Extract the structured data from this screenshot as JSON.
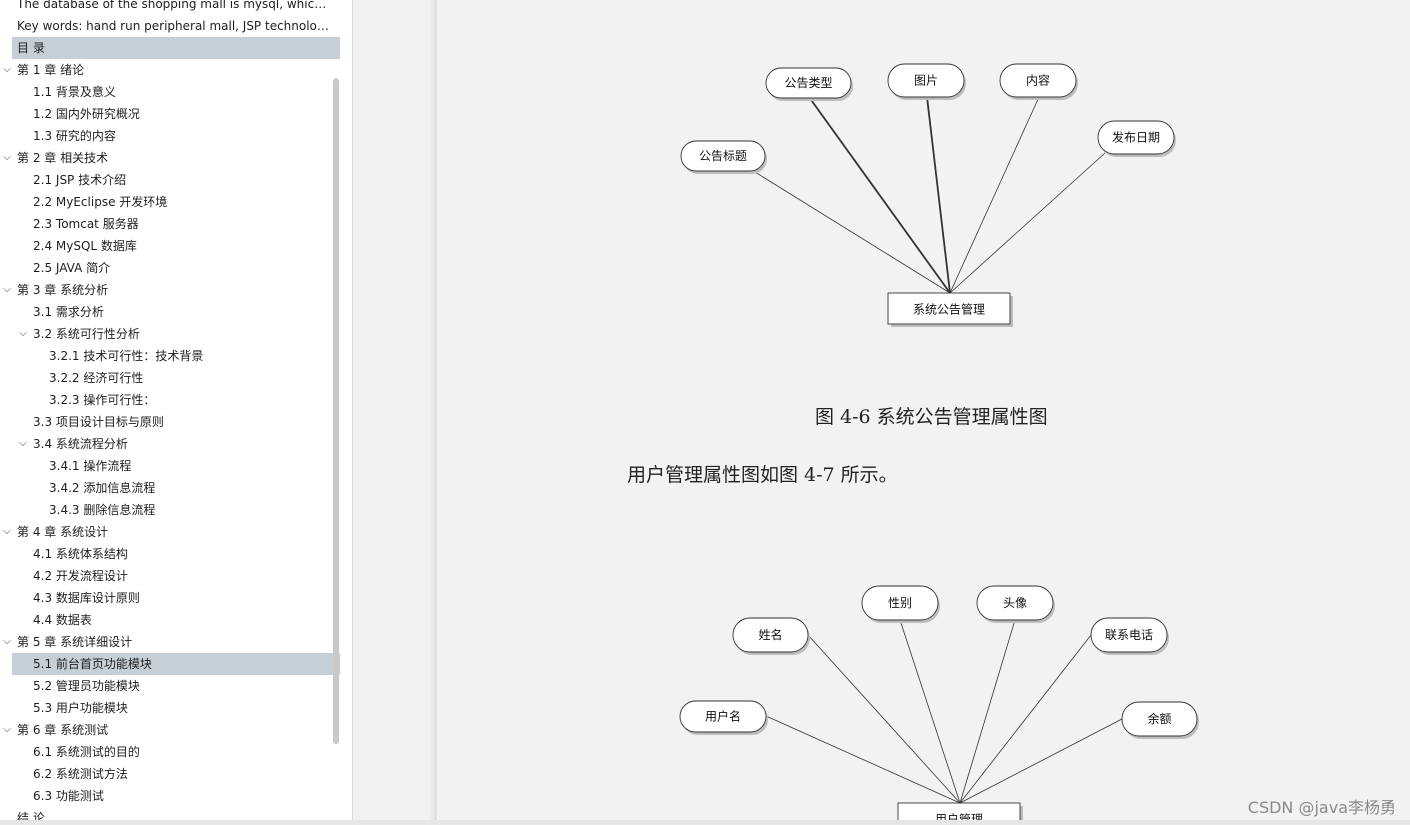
{
  "outline": [
    {
      "text": "The database of the shopping mall is mysql, which n...",
      "level": 0,
      "expander": false,
      "selected": false
    },
    {
      "text": "Key words: hand run peripheral mall, JSP technolog ...",
      "level": 0,
      "expander": false,
      "selected": false
    },
    {
      "text": "目  录",
      "level": 0,
      "expander": false,
      "selected": true
    },
    {
      "text": "第 1 章  绪论",
      "level": 0,
      "expander": true,
      "selected": false
    },
    {
      "text": "1.1 背景及意义",
      "level": 1,
      "expander": false,
      "selected": false
    },
    {
      "text": "1.2  国内外研究概况",
      "level": 1,
      "expander": false,
      "selected": false
    },
    {
      "text": "1.3  研究的内容",
      "level": 1,
      "expander": false,
      "selected": false
    },
    {
      "text": "第 2 章  相关技术",
      "level": 0,
      "expander": true,
      "selected": false
    },
    {
      "text": "2.1 JSP 技术介绍",
      "level": 1,
      "expander": false,
      "selected": false
    },
    {
      "text": "2.2 MyEclipse 开发环境",
      "level": 1,
      "expander": false,
      "selected": false
    },
    {
      "text": "2.3 Tomcat 服务器",
      "level": 1,
      "expander": false,
      "selected": false
    },
    {
      "text": "2.4 MySQL 数据库",
      "level": 1,
      "expander": false,
      "selected": false
    },
    {
      "text": "2.5 JAVA 简介",
      "level": 1,
      "expander": false,
      "selected": false
    },
    {
      "text": "第 3 章  系统分析",
      "level": 0,
      "expander": true,
      "selected": false
    },
    {
      "text": "3.1  需求分析",
      "level": 1,
      "expander": false,
      "selected": false
    },
    {
      "text": "3.2  系统可行性分析",
      "level": 1,
      "expander": true,
      "selected": false
    },
    {
      "text": "3.2.1 技术可行性：技术背景",
      "level": 2,
      "expander": false,
      "selected": false
    },
    {
      "text": "3.2.2 经济可行性",
      "level": 2,
      "expander": false,
      "selected": false
    },
    {
      "text": "3.2.3 操作可行性：",
      "level": 2,
      "expander": false,
      "selected": false
    },
    {
      "text": "3.3  项目设计目标与原则",
      "level": 1,
      "expander": false,
      "selected": false
    },
    {
      "text": "3.4 系统流程分析",
      "level": 1,
      "expander": true,
      "selected": false
    },
    {
      "text": "3.4.1 操作流程",
      "level": 2,
      "expander": false,
      "selected": false
    },
    {
      "text": "3.4.2 添加信息流程",
      "level": 2,
      "expander": false,
      "selected": false
    },
    {
      "text": "3.4.3 删除信息流程",
      "level": 2,
      "expander": false,
      "selected": false
    },
    {
      "text": "第 4 章  系统设计",
      "level": 0,
      "expander": true,
      "selected": false
    },
    {
      "text": "4.1  系统体系结构",
      "level": 1,
      "expander": false,
      "selected": false
    },
    {
      "text": "4.2 开发流程设计",
      "level": 1,
      "expander": false,
      "selected": false
    },
    {
      "text": "4.3  数据库设计原则",
      "level": 1,
      "expander": false,
      "selected": false
    },
    {
      "text": "4.4  数据表",
      "level": 1,
      "expander": false,
      "selected": false
    },
    {
      "text": "第 5 章  系统详细设计",
      "level": 0,
      "expander": true,
      "selected": false
    },
    {
      "text": "5.1 前台首页功能模块",
      "level": 1,
      "expander": false,
      "selected": true
    },
    {
      "text": "5.2 管理员功能模块",
      "level": 1,
      "expander": false,
      "selected": false
    },
    {
      "text": "5.3 用户功能模块",
      "level": 1,
      "expander": false,
      "selected": false
    },
    {
      "text": "第 6 章    系统测试",
      "level": 0,
      "expander": true,
      "selected": false
    },
    {
      "text": "6.1 系统测试的目的",
      "level": 1,
      "expander": false,
      "selected": false
    },
    {
      "text": "6.2 系统测试方法",
      "level": 1,
      "expander": false,
      "selected": false
    },
    {
      "text": "6.3 功能测试",
      "level": 1,
      "expander": false,
      "selected": false
    },
    {
      "text": "结  论",
      "level": 0,
      "expander": false,
      "selected": false
    }
  ],
  "diagram1": {
    "entity": "系统公告管理",
    "attributes": [
      "公告标题",
      "公告类型",
      "图片",
      "内容",
      "发布日期"
    ]
  },
  "figure_caption": "图 4-6 系统公告管理属性图",
  "body_line": "用户管理属性图如图 4-7 所示。",
  "diagram2": {
    "entity": "用户管理",
    "attributes": [
      "用户名",
      "姓名",
      "性别",
      "头像",
      "联系电话",
      "余额"
    ]
  },
  "watermark": "CSDN @java李杨勇"
}
